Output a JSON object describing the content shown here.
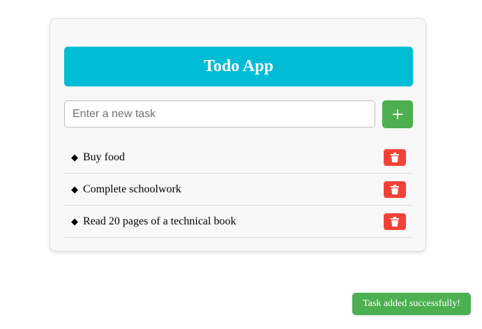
{
  "app": {
    "title": "Todo App"
  },
  "input": {
    "placeholder": "Enter a new task",
    "value": ""
  },
  "add_button": {
    "label": "+",
    "icon": "plus-icon"
  },
  "tasks": [
    {
      "bullet": "◆",
      "text": "Buy food",
      "delete_icon": "trash-icon"
    },
    {
      "bullet": "◆",
      "text": "Complete schoolwork",
      "delete_icon": "trash-icon"
    },
    {
      "bullet": "◆",
      "text": "Read 20 pages of a technical book",
      "delete_icon": "trash-icon"
    }
  ],
  "toast": {
    "message": "Task added successfully!"
  },
  "colors": {
    "header": "#00bcd4",
    "add_button": "#4caf50",
    "delete_button": "#f44336",
    "toast": "#4caf50",
    "card_background": "#f8f8f8"
  }
}
